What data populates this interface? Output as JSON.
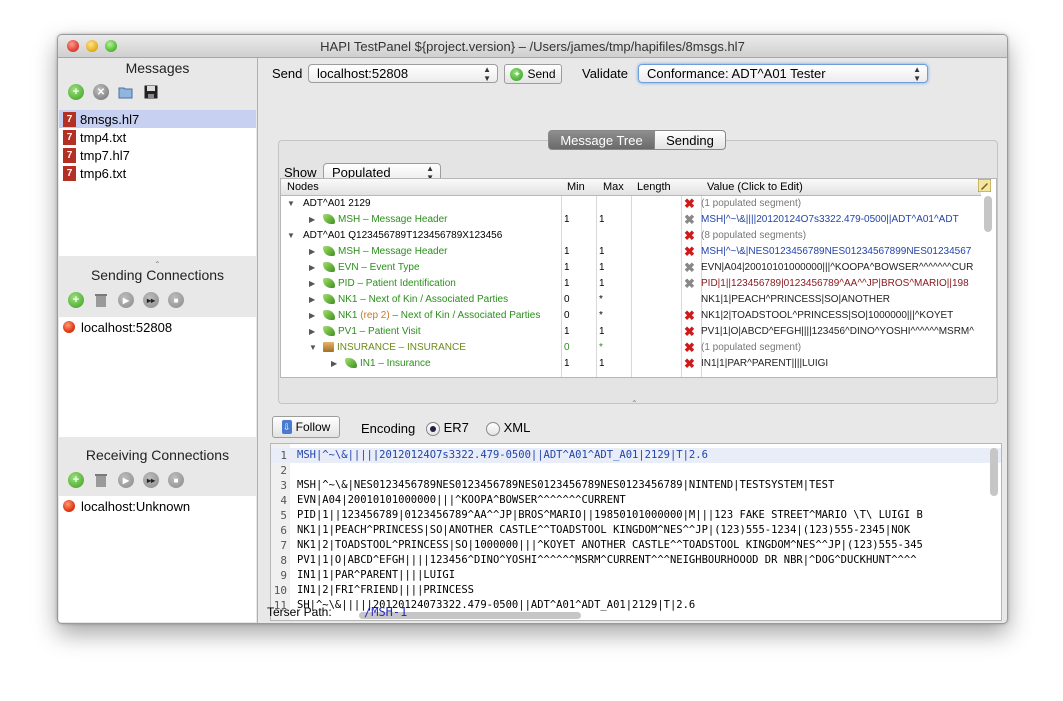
{
  "window": {
    "title": "HAPI TestPanel ${project.version} – /Users/james/tmp/hapifiles/8msgs.hl7"
  },
  "messages": {
    "title": "Messages",
    "files": [
      "8msgs.hl7",
      "tmp4.txt",
      "tmp7.hl7",
      "tmp6.txt"
    ],
    "file_badge": "7"
  },
  "sending": {
    "title": "Sending Connections",
    "connections": [
      "localhost:52808"
    ]
  },
  "receiving": {
    "title": "Receiving Connections",
    "connections": [
      "localhost:Unknown"
    ]
  },
  "toolbar": {
    "send_label": "Send",
    "send_target": "localhost:52808",
    "send_button": "Send",
    "validate_label": "Validate",
    "validate_value": "Conformance: ADT^A01 Tester"
  },
  "tabs": {
    "message_tree": "Message Tree",
    "sending": "Sending"
  },
  "show": {
    "label": "Show",
    "value": "Populated"
  },
  "tree": {
    "columns": [
      "Nodes",
      "Min",
      "Max",
      "Length",
      "Value (Click to Edit)"
    ],
    "rows": [
      {
        "node": "ADT^A01 2129",
        "min": "",
        "max": "",
        "mark": "x",
        "value": "(1 populated segment)"
      },
      {
        "node": "MSH – Message Header",
        "min": "1",
        "max": "1",
        "mark": "g",
        "value": "MSH|^~\\&||||20120124O7s3322.479-0500||ADT^A01^ADT"
      },
      {
        "node": "ADT^A01 Q123456789T123456789X123456",
        "min": "",
        "max": "",
        "mark": "x",
        "value": "(8 populated segments)"
      },
      {
        "node": "MSH – Message Header",
        "min": "1",
        "max": "1",
        "mark": "x",
        "value": "MSH|^~\\&|NES0123456789NES01234567899NES01234567"
      },
      {
        "node": "EVN – Event Type",
        "min": "1",
        "max": "1",
        "mark": "g",
        "value": "EVN|A04|20010101000000|||^KOOPA^BOWSER^^^^^^^CUR"
      },
      {
        "node": "PID – Patient Identification",
        "min": "1",
        "max": "1",
        "mark": "g",
        "value": "PID|1||123456789|0123456789^AA^^JP|BROS^MARIO||198"
      },
      {
        "node": "NK1 – Next of Kin / Associated Parties",
        "min": "0",
        "max": "*",
        "mark": "",
        "value": "NK1|1|PEACH^PRINCESS|SO|ANOTHER"
      },
      {
        "node": "NK1",
        "rep": "(rep 2)",
        "node2": "– Next of Kin / Associated Parties",
        "min": "0",
        "max": "*",
        "mark": "x",
        "value": "NK1|2|TOADSTOOL^PRINCESS|SO|1000000|||^KOYET"
      },
      {
        "node": "PV1 – Patient Visit",
        "min": "1",
        "max": "1",
        "mark": "x",
        "value": "PV1|1|O|ABCD^EFGH||||123456^DINO^YOSHI^^^^^^MSRM^"
      },
      {
        "node": "INSURANCE – INSURANCE",
        "min": "0",
        "max": "*",
        "mark": "x",
        "value": "(1 populated segment)"
      },
      {
        "node": "IN1 – Insurance",
        "min": "1",
        "max": "1",
        "mark": "x",
        "value": "IN1|1|PAR^PARENT||||LUIGI"
      }
    ]
  },
  "controls": {
    "follow": "Follow",
    "encoding_label": "Encoding",
    "er7": "ER7",
    "xml": "XML",
    "encoding_selected": "ER7"
  },
  "editor": {
    "lines": [
      "MSH|^~\\&|||||20120124O7s3322.479-0500||ADT^A01^ADT_A01|2129|T|2.6",
      "",
      "MSH|^~\\&|NES0123456789NES0123456789NES0123456789NES0123456789|NINTEND|TESTSYSTEM|TEST",
      "EVN|A04|20010101000000|||^KOOPA^BOWSER^^^^^^^CURRENT",
      "PID|1||123456789|0123456789^AA^^JP|BROS^MARIO||19850101000000|M|||123 FAKE STREET^MARIO \\T\\ LUIGI B",
      "NK1|1|PEACH^PRINCESS|SO|ANOTHER CASTLE^^TOADSTOOL KINGDOM^NES^^JP|(123)555-1234|(123)555-2345|NOK",
      "NK1|2|TOADSTOOL^PRINCESS|SO|1000000|||^KOYET ANOTHER CASTLE^^TOADSTOOL KINGDOM^NES^^JP|(123)555-345",
      "PV1|1|O|ABCD^EFGH||||123456^DINO^YOSHI^^^^^^MSRM^CURRENT^^^NEIGHBOURHOOOD DR NBR|^DOG^DUCKHUNT^^^^",
      "IN1|1|PAR^PARENT||||LUIGI",
      "IN1|2|FRI^FRIEND||||PRINCESS",
      "SH|^~\\&|||||20120124073322.479-0500||ADT^A01^ADT_A01|2129|T|2.6"
    ]
  },
  "terser": {
    "label": "Terser Path:",
    "value": "/MSH-1"
  }
}
